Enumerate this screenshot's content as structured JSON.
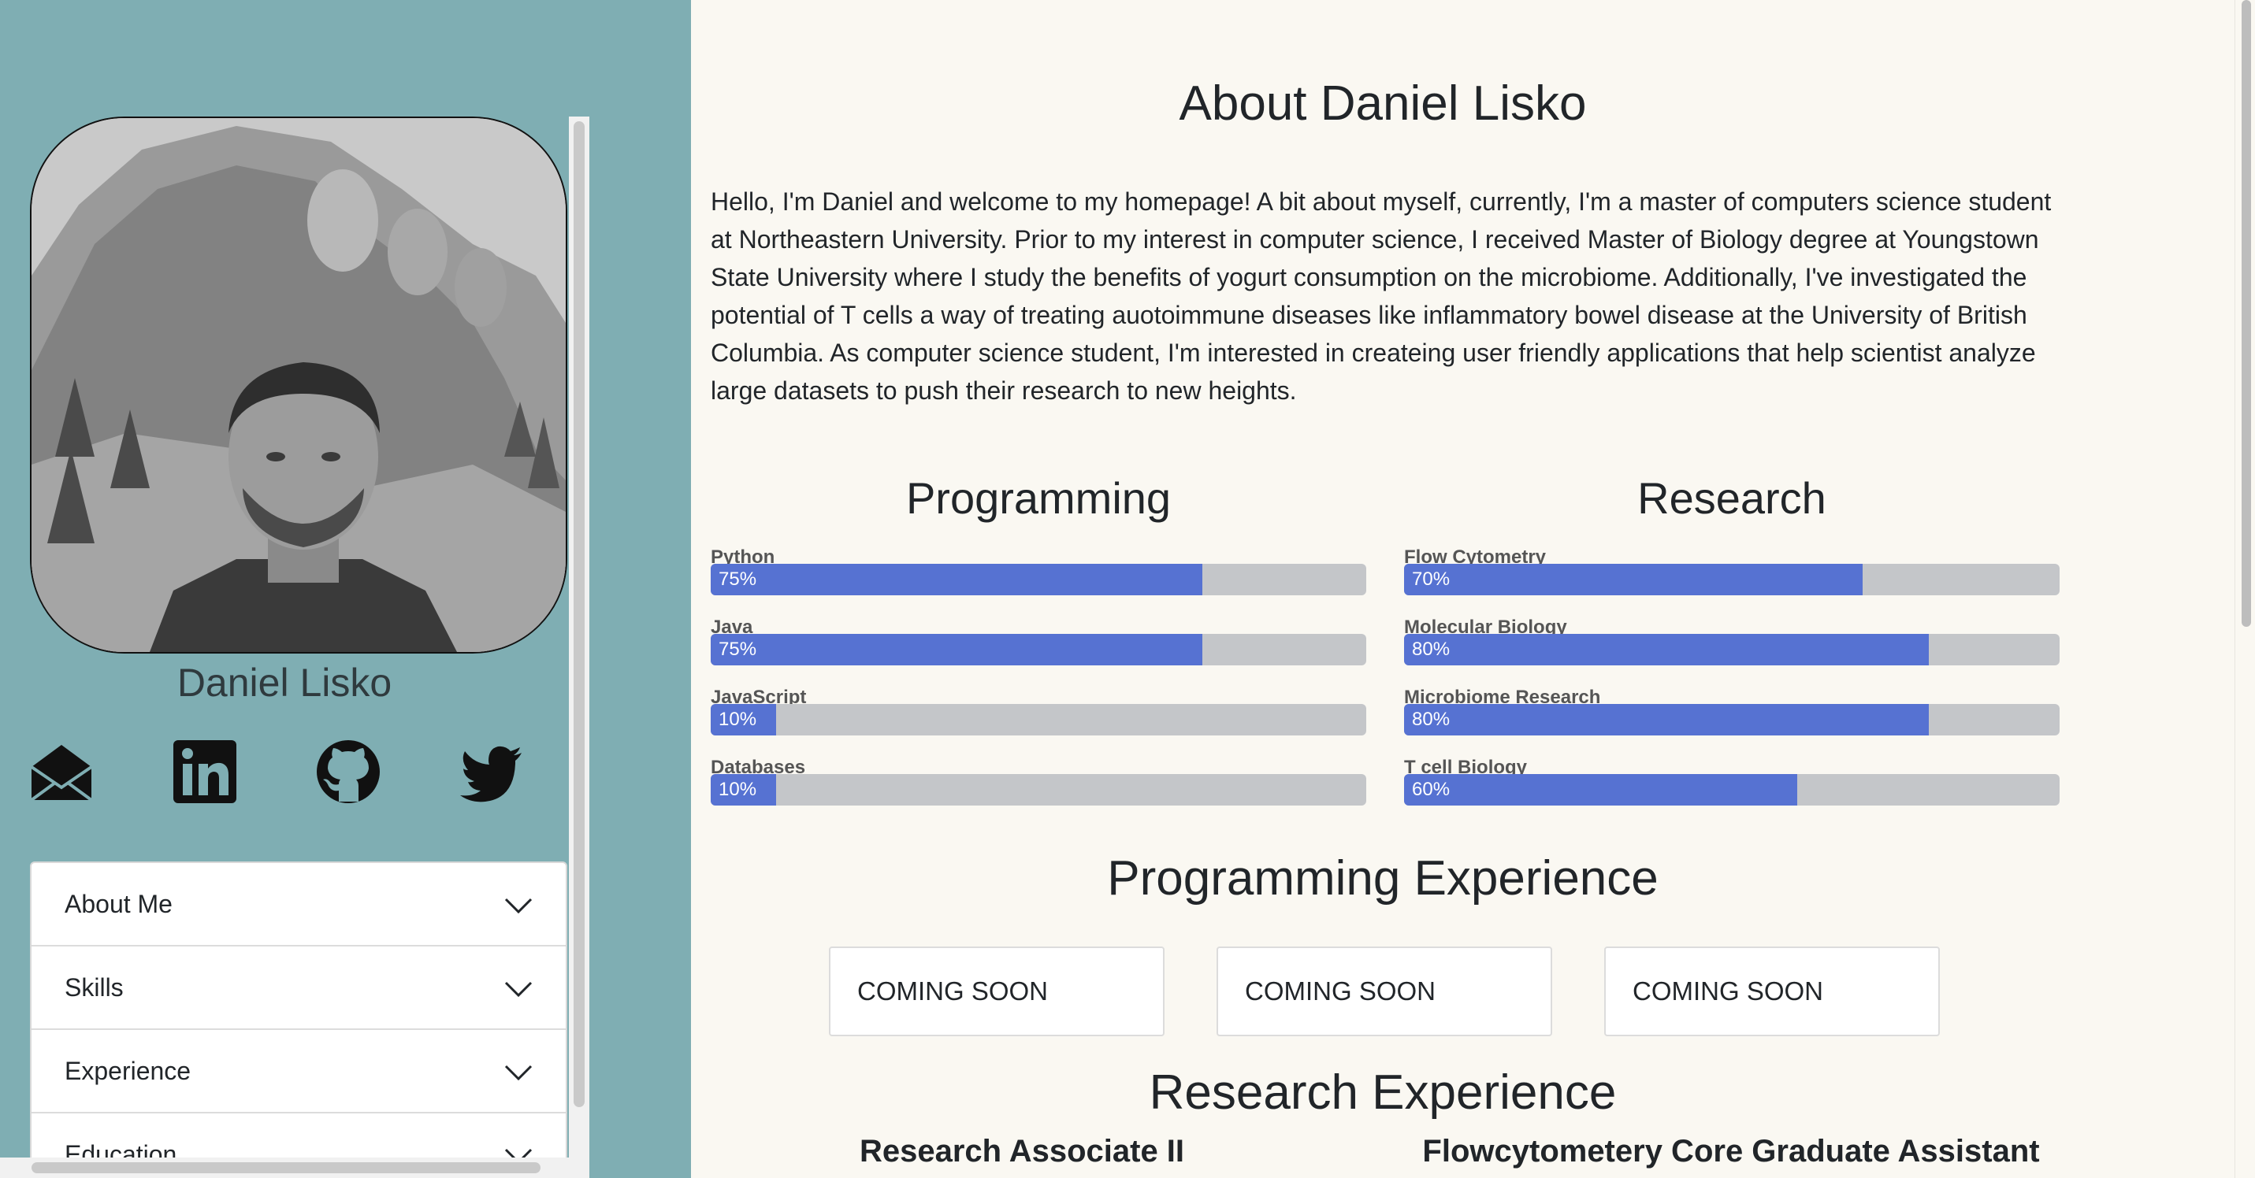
{
  "sidebar": {
    "name": "Daniel Lisko",
    "social": [
      {
        "icon": "envelope-icon"
      },
      {
        "icon": "linkedin-icon"
      },
      {
        "icon": "github-icon"
      },
      {
        "icon": "twitter-icon"
      }
    ],
    "accordion": [
      {
        "label": "About Me"
      },
      {
        "label": "Skills"
      },
      {
        "label": "Experience"
      },
      {
        "label": "Education"
      }
    ]
  },
  "about": {
    "title": "About Daniel Lisko",
    "text": "Hello, I'm Daniel and welcome to my homepage! A bit about myself, currently, I'm a master of computers science student at Northeastern University. Prior to my interest in computer science, I received Master of Biology degree at Youngstown State University where I study the benefits of yogurt consumption on the microbiome. Additionally, I've investigated the potential of T cells a way of treating auotoimmune diseases like inflammatory bowel disease at the University of British Columbia. As computer science student, I'm interested in createing user friendly applications that help scientist analyze large datasets to push their research to new heights."
  },
  "skills": {
    "programming": {
      "title": "Programming",
      "items": [
        {
          "label": "Python",
          "value": 75,
          "text": "75%"
        },
        {
          "label": "Java",
          "value": 75,
          "text": "75%"
        },
        {
          "label": "JavaScript",
          "value": 10,
          "text": "10%"
        },
        {
          "label": "Databases",
          "value": 10,
          "text": "10%"
        }
      ]
    },
    "research": {
      "title": "Research",
      "items": [
        {
          "label": "Flow Cytometry",
          "value": 70,
          "text": "70%"
        },
        {
          "label": "Molecular Biology",
          "value": 80,
          "text": "80%"
        },
        {
          "label": "Microbiome Research",
          "value": 80,
          "text": "80%"
        },
        {
          "label": "T cell Biology",
          "value": 60,
          "text": "60%"
        }
      ]
    }
  },
  "programming_experience": {
    "title": "Programming Experience",
    "cards": [
      "COMING SOON",
      "COMING SOON",
      "COMING SOON"
    ]
  },
  "research_experience": {
    "title": "Research Experience",
    "jobs": [
      "Research Associate II",
      "Flowcytometery Core Graduate Assistant"
    ]
  },
  "colors": {
    "sidebar_bg": "#7faeb3",
    "page_bg": "#faf8f2",
    "bar_fill": "#5672d2",
    "bar_track": "#c4c6c9"
  }
}
